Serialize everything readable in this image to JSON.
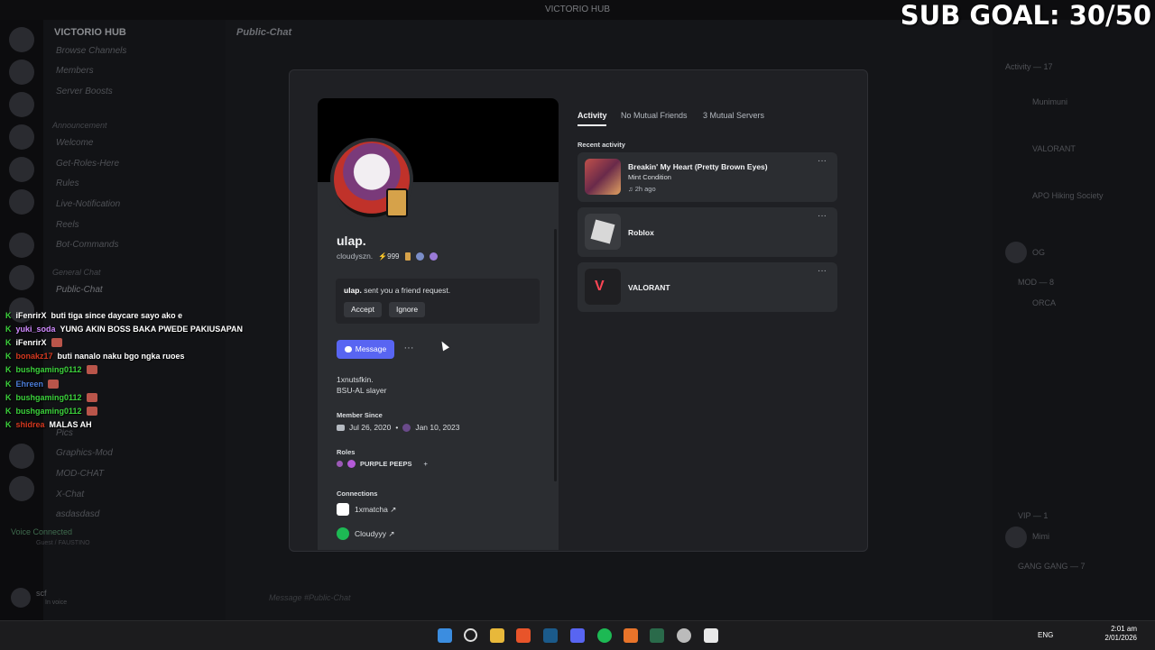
{
  "window": {
    "title": "VICTORIO HUB"
  },
  "overlay": {
    "sub_goal": "SUB GOAL: 30/50",
    "chat": [
      {
        "user": "iFenrirX",
        "color": "#ffffff",
        "text": "buti tiga since daycare sayo ako e"
      },
      {
        "user": "yuki_soda",
        "color": "#d08aff",
        "text": "YUNG AKIN BOSS BAKA PWEDE PAKIUSAPAN"
      },
      {
        "user": "iFenrirX",
        "color": "#ffffff",
        "text": ""
      },
      {
        "user": "bonakz17",
        "color": "#d4381f",
        "text": "buti nanalo naku bgo ngka ruoes"
      },
      {
        "user": "bushgaming0112",
        "color": "#3bd13b",
        "text": ""
      },
      {
        "user": "Ehreen",
        "color": "#4a7bd6",
        "text": ""
      },
      {
        "user": "bushgaming0112",
        "color": "#3bd13b",
        "text": ""
      },
      {
        "user": "bushgaming0112",
        "color": "#3bd13b",
        "text": ""
      },
      {
        "user": "shidrea",
        "color": "#d4381f",
        "text": "MALAS AH"
      }
    ]
  },
  "server": {
    "name": "VICTORIO HUB",
    "channels": [
      {
        "label": "Browse Channels",
        "top": 0
      },
      {
        "label": "Members",
        "top": 0
      },
      {
        "label": "Server Boosts",
        "top": 0
      }
    ],
    "category_announcement": "Announcement",
    "announce_channels": [
      "Welcome",
      "Get-Roles-Here",
      "Rules",
      "Live-Notification",
      "Reels",
      "Bot-Commands"
    ],
    "category_general": "General Chat",
    "general_channels": [
      "Public-Chat"
    ],
    "lower_channels": [
      "Pics",
      "Graphics-Mod",
      "MOD-CHAT",
      "X-Chat",
      "asdasdasd"
    ],
    "voice_status": "Voice Connected",
    "voice_sub": "Guest / FAUSTINO",
    "user_name": "scf",
    "user_status": "In voice"
  },
  "chat_header": "Public-Chat",
  "chat_input_placeholder": "Message #Public-Chat",
  "members": {
    "activity_header": "Activity — 17",
    "entries": [
      "Munimuni",
      "VALORANT",
      "APO Hiking Society",
      "OG",
      "ORCA",
      "MOD — 8",
      "VIP — 1",
      "Mimi",
      "GANG GANG — 7"
    ]
  },
  "profile": {
    "display_name": "ulap.",
    "username": "cloudyszn.",
    "badge_text": "999",
    "friend_request_user": "ulap.",
    "friend_request_text": " sent you a friend request.",
    "accept": "Accept",
    "ignore": "Ignore",
    "message": "Message",
    "more": "···",
    "bio_line1": "1xnutsfkin.",
    "bio_line2": "BSU-AL slayer",
    "member_since_h": "Member Since",
    "date_discord": "Jul 26, 2020",
    "date_server": "Jan 10, 2023",
    "roles_h": "Roles",
    "role": "PURPLE PEEPS",
    "connections_h": "Connections",
    "connections": [
      {
        "name": "1xmatcha ↗",
        "color": "#ffffff"
      },
      {
        "name": "Cloudyyy ↗",
        "color": "#1db954"
      }
    ]
  },
  "tabs": [
    {
      "label": "Activity",
      "active": true
    },
    {
      "label": "No Mutual Friends",
      "active": false
    },
    {
      "label": "3 Mutual Servers",
      "active": false
    }
  ],
  "recent_activity_h": "Recent activity",
  "activities": [
    {
      "title": "Breakin' My Heart (Pretty Brown Eyes)",
      "sub": "Mint Condition",
      "time": "♫ 2h ago",
      "icon_color": "#8a3a3a"
    },
    {
      "title": "Roblox",
      "sub": "",
      "time": "",
      "icon_color": "#3a3c40"
    },
    {
      "title": "VALORANT",
      "sub": "",
      "time": "",
      "icon_color": "#1f1f22"
    }
  ],
  "taskbar": {
    "lang": "ENG",
    "time": "2:01 am",
    "date": "2/01/2026"
  }
}
